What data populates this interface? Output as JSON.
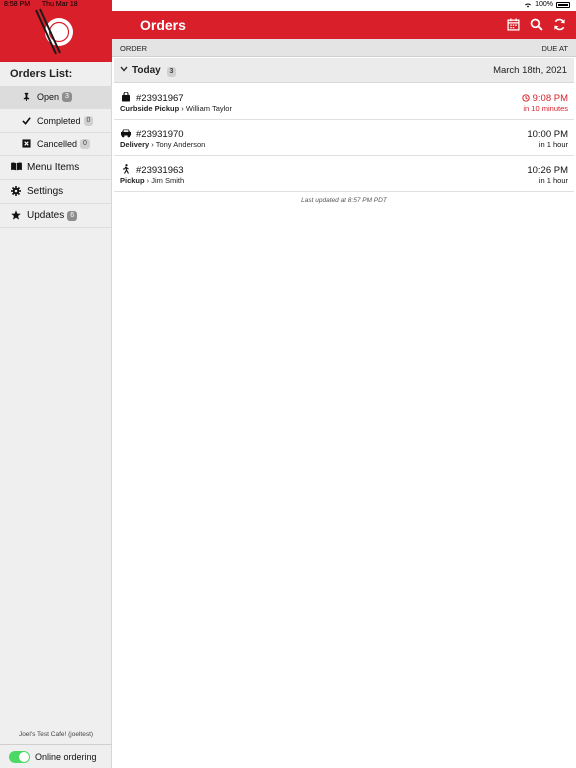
{
  "status_bar": {
    "time": "8:58 PM",
    "date": "Thu Mar 18",
    "battery": "100%"
  },
  "sidebar": {
    "orders_list_title": "Orders List:",
    "sub_items": [
      {
        "label": "Open",
        "count": "3",
        "icon": "pin-icon",
        "selected": true
      },
      {
        "label": "Completed",
        "count": "0",
        "icon": "check-icon",
        "selected": false
      },
      {
        "label": "Cancelled",
        "count": "0",
        "icon": "x-square-icon",
        "selected": false
      }
    ],
    "main_items": [
      {
        "label": "Menu Items",
        "icon": "book-icon"
      },
      {
        "label": "Settings",
        "icon": "gear-icon"
      },
      {
        "label": "Updates",
        "icon": "star-icon",
        "count": "6"
      }
    ],
    "cafe_name": "Joel's Test Cafe! (joeltest)",
    "online_ordering_label": "Online ordering",
    "online_ordering_enabled": true
  },
  "header": {
    "title": "Orders"
  },
  "columns": {
    "left": "ORDER",
    "right": "DUE AT"
  },
  "group": {
    "label": "Today",
    "count": "3",
    "date": "March 18th, 2021"
  },
  "orders": [
    {
      "number": "#23931967",
      "type": "Curbside Pickup",
      "customer": "William Taylor",
      "time": "9:08 PM",
      "relative": "in 10 minutes",
      "urgent": true,
      "icon": "bag-icon"
    },
    {
      "number": "#23931970",
      "type": "Delivery",
      "customer": "Tony Anderson",
      "time": "10:00 PM",
      "relative": "in 1 hour",
      "urgent": false,
      "icon": "car-icon"
    },
    {
      "number": "#23931963",
      "type": "Pickup",
      "customer": "Jim Smith",
      "time": "10:26 PM",
      "relative": "in 1 hour",
      "urgent": false,
      "icon": "walking-icon"
    }
  ],
  "last_updated": "Last updated at 8:57 PM PDT",
  "colors": {
    "accent": "#d81f2a",
    "toggle_on": "#4cd964"
  }
}
